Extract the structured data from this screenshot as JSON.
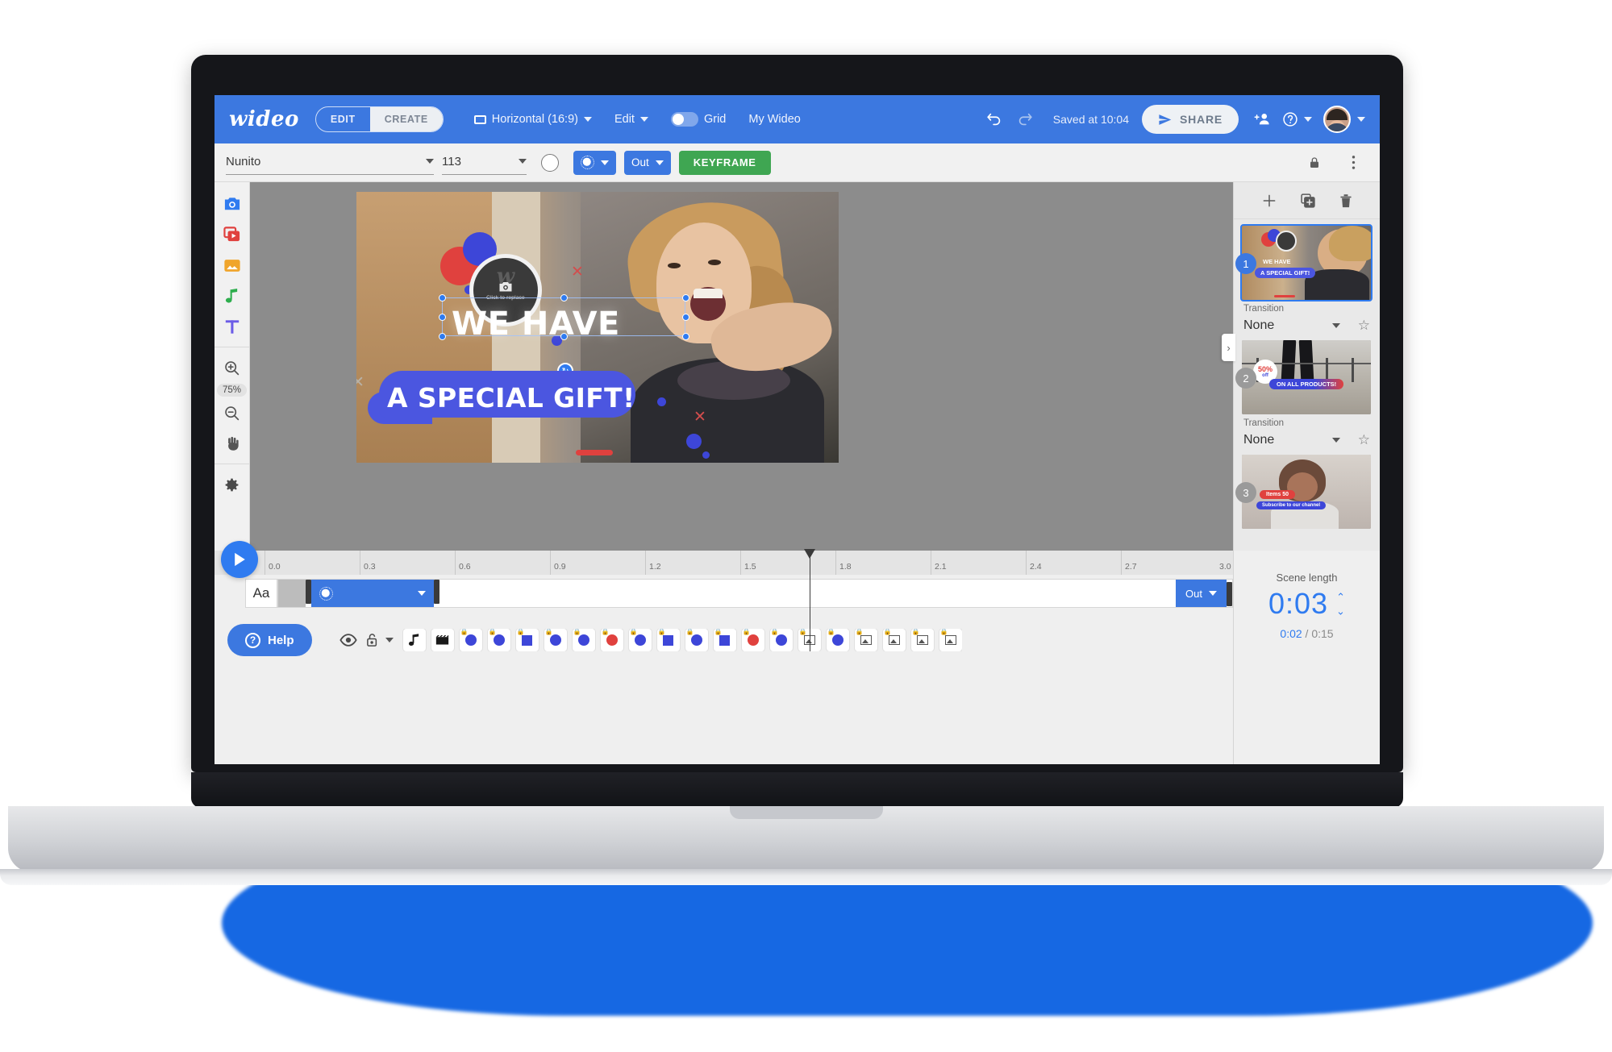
{
  "app": {
    "logo": "wideo",
    "mode_tabs": [
      {
        "label": "EDIT",
        "active": false
      },
      {
        "label": "CREATE",
        "active": true
      }
    ],
    "format": "Horizontal (16:9)",
    "edit_menu": "Edit",
    "grid_label": "Grid",
    "project_name": "My Wideo",
    "saved_status": "Saved at 10:04",
    "share_label": "SHARE",
    "accent_blue": "#3c78e0",
    "keyframe_green": "#3fa652"
  },
  "property_toolbar": {
    "font_family": "Nunito",
    "font_size": "113",
    "color_swatch": "#ffffff",
    "animation_label": "animation-in",
    "direction": "Out",
    "keyframe_label": "KEYFRAME",
    "lock_icon": "lock-icon",
    "more_icon": "more-vertical-icon"
  },
  "left_rail": {
    "tools": [
      {
        "name": "camera-icon",
        "color": "#2f7bf0"
      },
      {
        "name": "video-icon",
        "color": "#e0413e"
      },
      {
        "name": "image-icon",
        "color": "#f0a52b"
      },
      {
        "name": "music-icon",
        "color": "#2eae4e"
      },
      {
        "name": "text-icon",
        "color": "#6b5ce7"
      }
    ],
    "zoom_in": "zoom-in-icon",
    "zoom_level": "75%",
    "zoom_out": "zoom-out-icon",
    "hand": "hand-icon",
    "settings": "gear-icon"
  },
  "canvas": {
    "logo_placeholder": {
      "watermark": "w",
      "caption": "Click to replace"
    },
    "text_lines": [
      {
        "text": "WE HAVE",
        "selected": true
      },
      {
        "text": "A SPECIAL GIFT!",
        "selected": false
      }
    ]
  },
  "scene_panel": {
    "tools": [
      {
        "name": "add-scene-icon",
        "glyph": "+"
      },
      {
        "name": "duplicate-scene-icon",
        "glyph": "⧉"
      },
      {
        "name": "delete-scene-icon",
        "glyph": "🗑"
      }
    ],
    "collapse_arrow": "›",
    "scenes": [
      {
        "number": "1",
        "selected": true,
        "transition_label": "Transition",
        "transition_value": "None",
        "favorite_icon": "star-icon",
        "thumb_text": [
          "WE HAVE",
          "A SPECIAL GIFT!"
        ]
      },
      {
        "number": "2",
        "selected": false,
        "transition_label": "Transition",
        "transition_value": "None",
        "favorite_icon": "star-icon",
        "thumb_text": [
          "50%",
          "off",
          "ON ALL PRODUCTS!"
        ]
      },
      {
        "number": "3",
        "selected": false,
        "transition_label": "",
        "transition_value": "",
        "favorite_icon": "",
        "thumb_text": [
          "Items 50",
          "Subscribe to our channel"
        ]
      }
    ]
  },
  "timeline": {
    "play_icon": "play-icon",
    "ticks": [
      "0.0",
      "0.3",
      "0.6",
      "0.9",
      "1.2",
      "1.5",
      "1.8",
      "2.1",
      "2.4",
      "2.7",
      "3.0"
    ],
    "playhead_position": "1.72",
    "track_label": "Aa",
    "clip_out_label": "Out",
    "help_label": "Help",
    "layer_controls": [
      {
        "name": "visibility-eye-icon"
      },
      {
        "name": "unlock-icon"
      },
      {
        "name": "chevron-down-icon"
      }
    ],
    "layer_items": [
      {
        "name": "music-layer-icon",
        "kind": "music"
      },
      {
        "name": "video-layer-icon",
        "kind": "clapper"
      },
      {
        "name": "object-layer-circle",
        "kind": "circle-blue",
        "locked": true
      },
      {
        "name": "object-layer-circle",
        "kind": "circle-blue",
        "locked": true
      },
      {
        "name": "object-layer-square",
        "kind": "square-blue",
        "locked": true
      },
      {
        "name": "object-layer-circle",
        "kind": "circle-blue",
        "locked": true
      },
      {
        "name": "object-layer-circle",
        "kind": "circle-blue",
        "locked": true
      },
      {
        "name": "object-layer-circle",
        "kind": "circle-red",
        "locked": true
      },
      {
        "name": "object-layer-circle",
        "kind": "circle-blue",
        "locked": true
      },
      {
        "name": "object-layer-square",
        "kind": "square-blue",
        "locked": true
      },
      {
        "name": "object-layer-circle",
        "kind": "circle-blue",
        "locked": true
      },
      {
        "name": "object-layer-square",
        "kind": "square-blue",
        "locked": true
      },
      {
        "name": "object-layer-circle",
        "kind": "circle-red",
        "locked": true
      },
      {
        "name": "object-layer-circle",
        "kind": "circle-blue",
        "locked": true
      },
      {
        "name": "object-layer-image",
        "kind": "image",
        "locked": true
      },
      {
        "name": "object-layer-circle",
        "kind": "circle-blue",
        "locked": true
      },
      {
        "name": "object-layer-image",
        "kind": "image",
        "locked": true
      },
      {
        "name": "object-layer-image",
        "kind": "image",
        "locked": true
      },
      {
        "name": "object-layer-image",
        "kind": "image",
        "locked": true
      },
      {
        "name": "object-layer-image",
        "kind": "image",
        "locked": true
      }
    ]
  },
  "scene_length": {
    "label": "Scene length",
    "value": "0:03",
    "current": "0:02",
    "separator": "/",
    "total": "0:15"
  }
}
